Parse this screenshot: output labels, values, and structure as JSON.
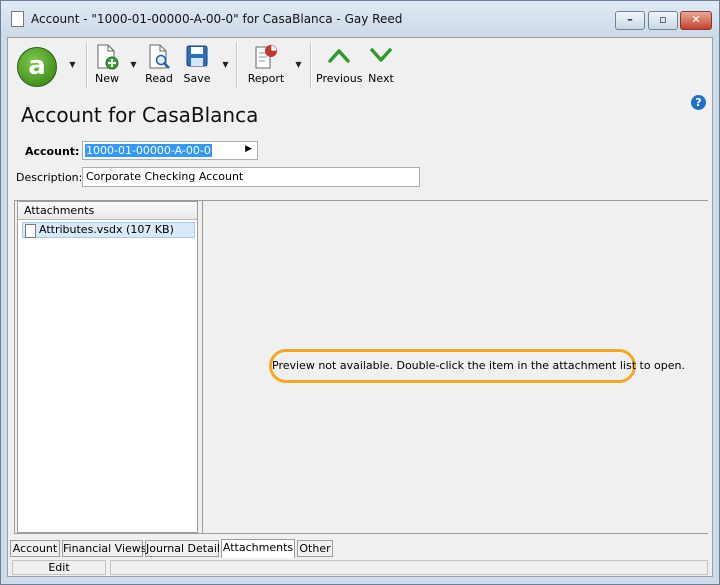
{
  "window": {
    "title": "Account - \"1000-01-00000-A-00-0\" for CasaBlanca - Gay Reed"
  },
  "window_controls": {
    "minimize_glyph": "–",
    "restore_glyph": "▫",
    "close_glyph": "✕"
  },
  "toolbar": {
    "logo_letter": "a",
    "dropdown_glyph": "▼",
    "new_label": "New",
    "read_label": "Read",
    "save_label": "Save",
    "report_label": "Report",
    "previous_label": "Previous",
    "next_label": "Next"
  },
  "help": {
    "glyph": "?"
  },
  "page": {
    "title": "Account for CasaBlanca"
  },
  "form": {
    "account_label": "Account:",
    "account_value": "1000-01-00000-A-00-0",
    "account_arrow": "▶",
    "description_label": "Description:",
    "description_value": "Corporate Checking Account"
  },
  "attachments": {
    "header": "Attachments",
    "items": [
      {
        "name": "Attributes.vsdx (107 KB)"
      }
    ]
  },
  "preview": {
    "message": "Preview not available. Double-click the item in the attachment list to open."
  },
  "tabs": [
    {
      "label": "Account"
    },
    {
      "label": "Financial Views"
    },
    {
      "label": "Journal Detail"
    },
    {
      "label": "Attachments",
      "active": true
    },
    {
      "label": "Other"
    }
  ],
  "status": {
    "mode": "Edit"
  },
  "colors": {
    "accent_highlight": "#f5a623",
    "selection": "#3399ff",
    "logo_green": "#4aa51f",
    "nav_green": "#2e9a2e"
  }
}
